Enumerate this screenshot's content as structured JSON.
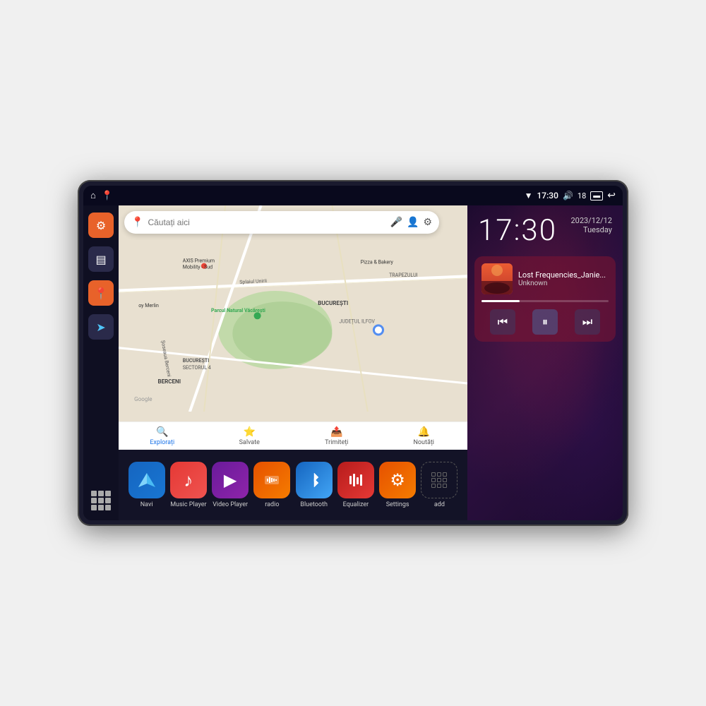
{
  "device": {
    "status_bar": {
      "wifi_icon": "▼",
      "time": "17:30",
      "volume_icon": "🔊",
      "battery_level": "18",
      "battery_icon": "▭",
      "back_icon": "↩",
      "home_icon": "⌂",
      "maps_icon": "📍"
    },
    "sidebar": {
      "settings_icon": "⚙",
      "files_icon": "▤",
      "maps_icon": "📍",
      "navigation_icon": "➤",
      "apps_icon": "⋮⋮⋮"
    },
    "map": {
      "search_placeholder": "Căutați aici",
      "location_hint": "📍",
      "roads": [
        "Splaiul Unirii",
        "Șoseaua Berceni"
      ],
      "places": [
        "AXIS Premium Mobility - Sud",
        "Pizza & Bakery",
        "Parcul Natural Văcărești",
        "BUCUREȘTI SECTORUL 4",
        "BUCUREȘTI",
        "JUDEȚUL ILFOV",
        "BERCENI",
        "TRAPEZULUI",
        "Google"
      ],
      "bottom_items": [
        {
          "label": "Explorați",
          "icon": "🔍",
          "active": true
        },
        {
          "label": "Salvate",
          "icon": "⭐",
          "active": false
        },
        {
          "label": "Trimiteți",
          "icon": "📤",
          "active": false
        },
        {
          "label": "Noutăți",
          "icon": "🔔",
          "active": false
        }
      ]
    },
    "right_panel": {
      "clock": {
        "time": "17:30",
        "date": "2023/12/12",
        "day": "Tuesday"
      },
      "music": {
        "track_name": "Lost Frequencies_Janie...",
        "artist": "Unknown",
        "progress": 30
      }
    },
    "apps": [
      {
        "name": "Navi",
        "icon_color": "#1565c0",
        "icon": "➤",
        "bg": "linear-gradient(135deg,#1565c0,#1976d2)"
      },
      {
        "name": "Music Player",
        "icon_color": "#e53935",
        "icon": "♪",
        "bg": "linear-gradient(135deg,#e53935,#ef5350)"
      },
      {
        "name": "Video Player",
        "icon_color": "#6a1b9a",
        "icon": "▶",
        "bg": "linear-gradient(135deg,#6a1b9a,#8e24aa)"
      },
      {
        "name": "radio",
        "icon_color": "#e65100",
        "icon": "📻",
        "bg": "linear-gradient(135deg,#e65100,#f57c00)"
      },
      {
        "name": "Bluetooth",
        "icon_color": "#1565c0",
        "icon": "⚡",
        "bg": "linear-gradient(135deg,#1565c0,#42a5f5)"
      },
      {
        "name": "Equalizer",
        "icon_color": "#b71c1c",
        "icon": "≡",
        "bg": "linear-gradient(135deg,#b71c1c,#e53935)"
      },
      {
        "name": "Settings",
        "icon_color": "#e65100",
        "icon": "⚙",
        "bg": "linear-gradient(135deg,#e65100,#f57c00)"
      },
      {
        "name": "add",
        "icon_color": "#555",
        "icon": "grid",
        "bg": "transparent"
      }
    ],
    "music_controls": {
      "prev": "⏮",
      "play": "⏸",
      "next": "⏭"
    }
  }
}
